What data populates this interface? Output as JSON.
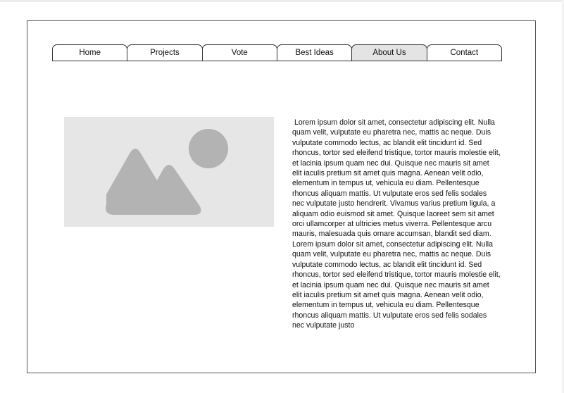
{
  "nav": {
    "tabs": [
      {
        "label": "Home"
      },
      {
        "label": "Projects"
      },
      {
        "label": "Vote"
      },
      {
        "label": "Best Ideas"
      },
      {
        "label": "About Us",
        "active": true
      },
      {
        "label": "Contact"
      }
    ]
  },
  "image": {
    "icon": "image-placeholder-icon",
    "background": "#e6e6e6",
    "icon_color": "#b3b3b3"
  },
  "content": {
    "paragraph": " Lorem ipsum dolor sit amet, consectetur adipiscing elit. Nulla quam velit, vulputate eu pharetra nec, mattis ac neque. Duis vulputate commodo lectus, ac blandit elit tincidunt id. Sed rhoncus, tortor sed eleifend tristique, tortor mauris molestie elit, et lacinia ipsum quam nec dui. Quisque nec mauris sit amet elit iaculis pretium sit amet quis magna. Aenean velit odio, elementum in tempus ut, vehicula eu diam. Pellentesque rhoncus aliquam mattis. Ut vulputate eros sed felis sodales nec vulputate justo hendrerit. Vivamus varius pretium ligula, a aliquam odio euismod sit amet. Quisque laoreet sem sit amet orci ullamcorper at ultricies metus viverra. Pellentesque arcu mauris, malesuada quis ornare accumsan, blandit sed diam.  Lorem ipsum dolor sit amet, consectetur adipiscing elit. Nulla quam velit, vulputate eu pharetra nec, mattis ac neque. Duis vulputate commodo lectus, ac blandit elit tincidunt id. Sed rhoncus, tortor sed eleifend tristique, tortor mauris molestie elit, et lacinia ipsum quam nec dui. Quisque nec mauris sit amet elit iaculis pretium sit amet quis magna. Aenean velit odio, elementum in tempus ut, vehicula eu diam. Pellentesque rhoncus aliquam mattis. Ut vulputate eros sed felis sodales nec vulputate justo"
  }
}
